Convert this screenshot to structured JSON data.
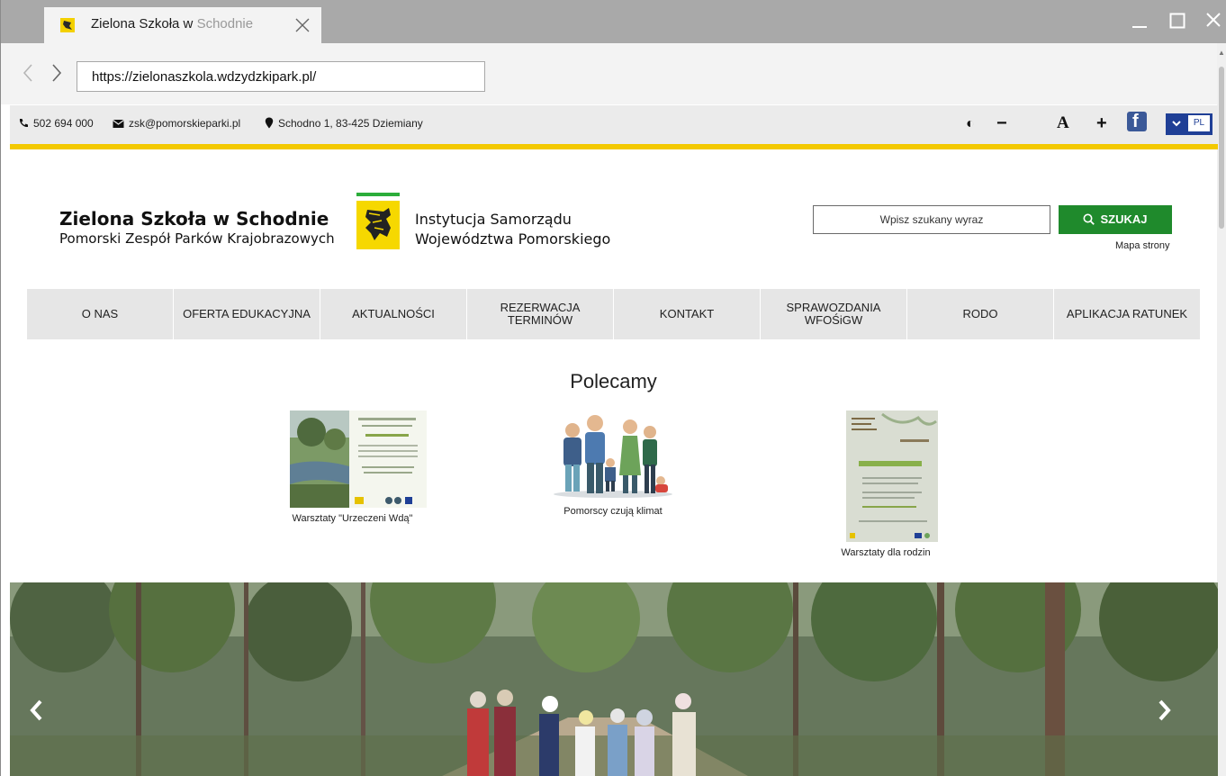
{
  "browser": {
    "tab_title": "Zielona Szkoła w Schodnie",
    "tab_title_visible": "Zielona Szkoła w ",
    "tab_title_faded": "Schodnie",
    "url": "https://zielonaszkola.wdzydzkipark.pl/",
    "window_minimize_icon": "minimize-icon",
    "window_maximize_icon": "maximize-icon",
    "window_close_icon": "close-icon"
  },
  "topbar": {
    "phone": "502 694 000",
    "email": "zsk@pomorskieparki.pl",
    "address": "Schodno 1, 83-425 Dziemiany",
    "contrast_symbol": "◐",
    "font_decrease": "−",
    "font_default": "A",
    "font_increase": "+",
    "facebook_letter": "f",
    "lang_chevron": "⌄",
    "lang_code": "PL",
    "accent_color": "#f3c900"
  },
  "header": {
    "site_name": "Zielona Szkoła w Schodnie",
    "site_subtitle": "Pomorski Zespół Parków Krajobrazowych",
    "institution_line1": "Instytucja Samorządu",
    "institution_line2": "Województwa Pomorskiego",
    "search_placeholder": "Wpisz szukany wyraz",
    "search_button": "SZUKAJ",
    "sitemap_link": "Mapa strony",
    "search_button_color": "#1f8a2c"
  },
  "nav": {
    "items": [
      {
        "label": "O NAS"
      },
      {
        "label": "OFERTA EDUKACYJNA"
      },
      {
        "label": "AKTUALNOŚCI"
      },
      {
        "label": "REZERWACJA TERMINÓW"
      },
      {
        "label": "KONTAKT"
      },
      {
        "label": "SPRAWOZDANIA WFOŚiGW"
      },
      {
        "label": "RODO"
      },
      {
        "label": "APLIKACJA RATUNEK"
      }
    ]
  },
  "featured": {
    "title": "Polecamy",
    "cards": [
      {
        "caption": "Warsztaty \"Urzeczeni Wdą\""
      },
      {
        "caption": "Pomorscy czują klimat"
      },
      {
        "caption": "Warsztaty dla rodzin"
      }
    ]
  },
  "hero": {
    "prev_arrow": "‹",
    "next_arrow": "›"
  }
}
